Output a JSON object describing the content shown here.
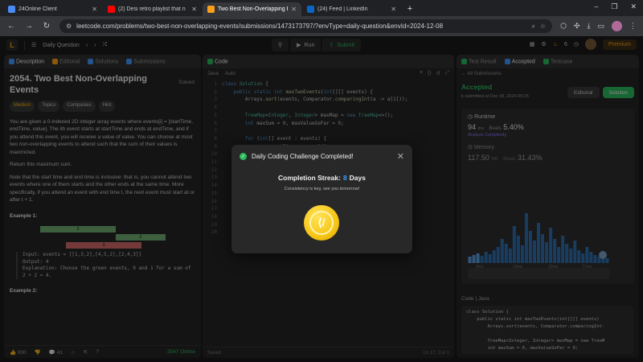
{
  "browser": {
    "tabs": [
      {
        "label": "24Online Client",
        "color": "#4a8af4"
      },
      {
        "label": "(2) Desi retro playlist that n",
        "color": "#ff0000"
      },
      {
        "label": "Two Best Non-Overlapping Eve",
        "color": "#f89f1b"
      },
      {
        "label": "(24) Feed | LinkedIn",
        "color": "#0a66c2"
      }
    ],
    "url": "leetcode.com/problems/two-best-non-overlapping-events/submissions/1473173797/?envType=daily-question&envId=2024-12-08",
    "new_tab": "+"
  },
  "lcnav": {
    "logo": "L",
    "daily_question": "Daily Question",
    "run": "Run",
    "submit": "Submit",
    "streak_count": "6",
    "premium": "Premium"
  },
  "description": {
    "tabs": [
      "Description",
      "Editorial",
      "Solutions",
      "Submissions"
    ],
    "title": "2054. Two Best Non-Overlapping Events",
    "solved": "Solved",
    "tags": [
      "Medium",
      "Topics",
      "Companies",
      "Hint"
    ],
    "p1": "You are given a 0-indexed 2D integer array events where events[i] = [startTime, endTime, value]. The ith event starts at startTime and ends at endTime, and if you attend this event, you will receive a value of value. You can choose at most two non-overlapping events to attend such that the sum of their values is maximized.",
    "p2": "Return this maximum sum.",
    "p3": "Note that the start time and end time is inclusive: that is, you cannot attend two events where one of them starts and the other ends at the same time. More specifically, if you attend an event with end time t, the next event must start at or after t + 1.",
    "example1_title": "Example 1:",
    "example1_input": "Input: events = [[1,3,2],[4,5,2],[2,4,3]]",
    "example1_output": "Output: 4",
    "example1_expl": "Explanation: Choose the green events, 0 and 1 for a sum of 2 + 2 = 4.",
    "example2_title": "Example 2:",
    "bar_labels": [
      "2",
      "2",
      "3"
    ],
    "footer": {
      "likes": "930",
      "comments": "41",
      "online": "3547 Online"
    }
  },
  "code": {
    "tab": "Code",
    "language": "Java",
    "mode": "Auto",
    "footer_left": "Saved",
    "footer_right": "Ln 17, Col 1"
  },
  "result": {
    "tabs": [
      "Test Result",
      "Accepted",
      "Testcase"
    ],
    "all_submissions": "All Submissions",
    "status": "Accepted",
    "submitted": "k submitted at Dec 08, 2024 09:26",
    "editorial": "Editorial",
    "solution": "Solution",
    "runtime_label": "Runtime",
    "runtime_value": "94",
    "runtime_unit": "ms",
    "beats_label": "Beats",
    "runtime_beats": "5.40%",
    "analyze": "Analyze Complexity",
    "memory_label": "Memory",
    "memory_value": "117.50",
    "memory_unit": "MB",
    "memory_beats": "31.43%",
    "x_ticks": [
      "5ms",
      "10ms",
      "15ms",
      "77ms"
    ],
    "code_label": "Code | Java",
    "code_preview": "class Solution {\n    public static int maxTwoEvents(int[][] events)\n        Arrays.sort(events, Comparator.comparingInt-\n\n        TreeMap<Integer, Integer> maxMap = new TreeM\n        int maxSum = 0, maxValueSoFar = 0;"
  },
  "modal": {
    "title": "Daily Coding Challenge Completed!",
    "streak_label": "Completion Streak:",
    "streak_value": "8",
    "streak_unit": "Days",
    "subtitle": "Consistency is key, see you tomorrow!"
  }
}
